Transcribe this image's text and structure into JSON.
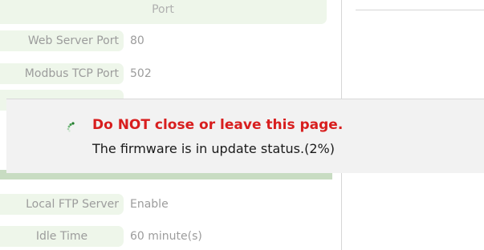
{
  "header": {
    "column_label": "Port"
  },
  "port_rows": [
    {
      "label": "Web Server Port",
      "value": "80"
    },
    {
      "label": "Modbus TCP Port",
      "value": "502"
    }
  ],
  "ftp_rows": [
    {
      "label": "Local FTP Server",
      "value": "Enable"
    },
    {
      "label": "Idle Time",
      "value": "60 minute(s)"
    }
  ],
  "update_dialog": {
    "warning": "Do NOT close or leave this page.",
    "status": "The firmware is in update status.(2%)",
    "progress_percent": 2,
    "icon": "loading-spinner-icon"
  },
  "colors": {
    "label_background": "#eef6ea",
    "warning": "#d81e1e",
    "accent_green": "#9bbf8f"
  }
}
